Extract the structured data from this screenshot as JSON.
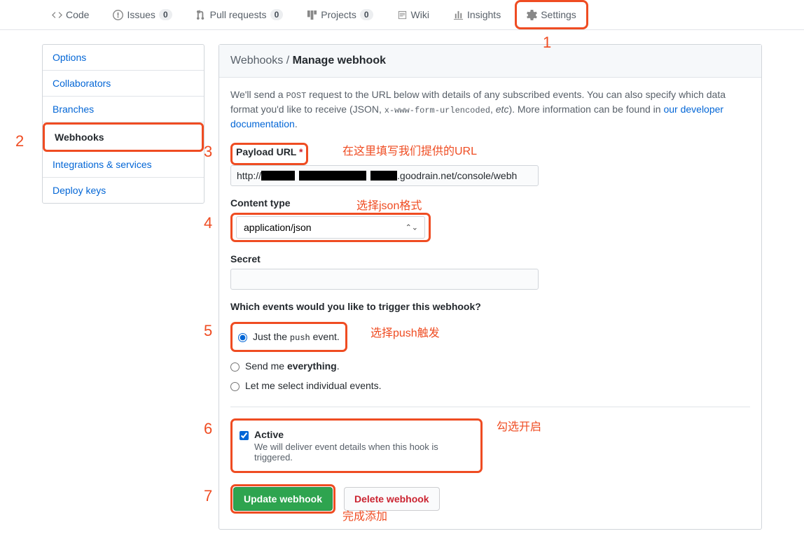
{
  "nav": {
    "code": "Code",
    "issues": "Issues",
    "issues_count": "0",
    "pull_requests": "Pull requests",
    "pr_count": "0",
    "projects": "Projects",
    "projects_count": "0",
    "wiki": "Wiki",
    "insights": "Insights",
    "settings": "Settings"
  },
  "sidebar": {
    "options": "Options",
    "collaborators": "Collaborators",
    "branches": "Branches",
    "webhooks": "Webhooks",
    "integrations": "Integrations & services",
    "deploy_keys": "Deploy keys"
  },
  "header": {
    "crumb": "Webhooks / ",
    "current": "Manage webhook"
  },
  "desc": {
    "p1a": "We'll send a ",
    "p1code": "POST",
    "p1b": " request to the URL below with details of any subscribed events. You can also specify which data format you'd like to receive (JSON, ",
    "p1code2": "x-www-form-urlencoded",
    "p1c": ", ",
    "p1em": "etc",
    "p1d": "). More information can be found in ",
    "link": "our developer documentation",
    "p1e": "."
  },
  "form": {
    "payload_label": "Payload URL",
    "payload_prefix": "http://",
    "payload_suffix": ".goodrain.net/console/webh",
    "content_type_label": "Content type",
    "content_type_value": "application/json",
    "secret_label": "Secret",
    "secret_value": "",
    "events_title": "Which events would you like to trigger this webhook?",
    "opt_push_a": "Just the ",
    "opt_push_code": "push",
    "opt_push_b": " event.",
    "opt_everything_a": "Send me ",
    "opt_everything_b": "everything",
    "opt_everything_c": ".",
    "opt_individual": "Let me select individual events.",
    "active_label": "Active",
    "active_note": "We will deliver event details when this hook is triggered.",
    "btn_update": "Update webhook",
    "btn_delete": "Delete webhook"
  },
  "anno": {
    "n1": "1",
    "n2": "2",
    "n3": "3",
    "n4": "4",
    "n5": "5",
    "n6": "6",
    "n7": "7",
    "t_url": "在这里填写我们提供的URL",
    "t_json": "选择json格式",
    "t_push": "选择push触发",
    "t_active": "勾选开启",
    "t_done": "完成添加"
  }
}
